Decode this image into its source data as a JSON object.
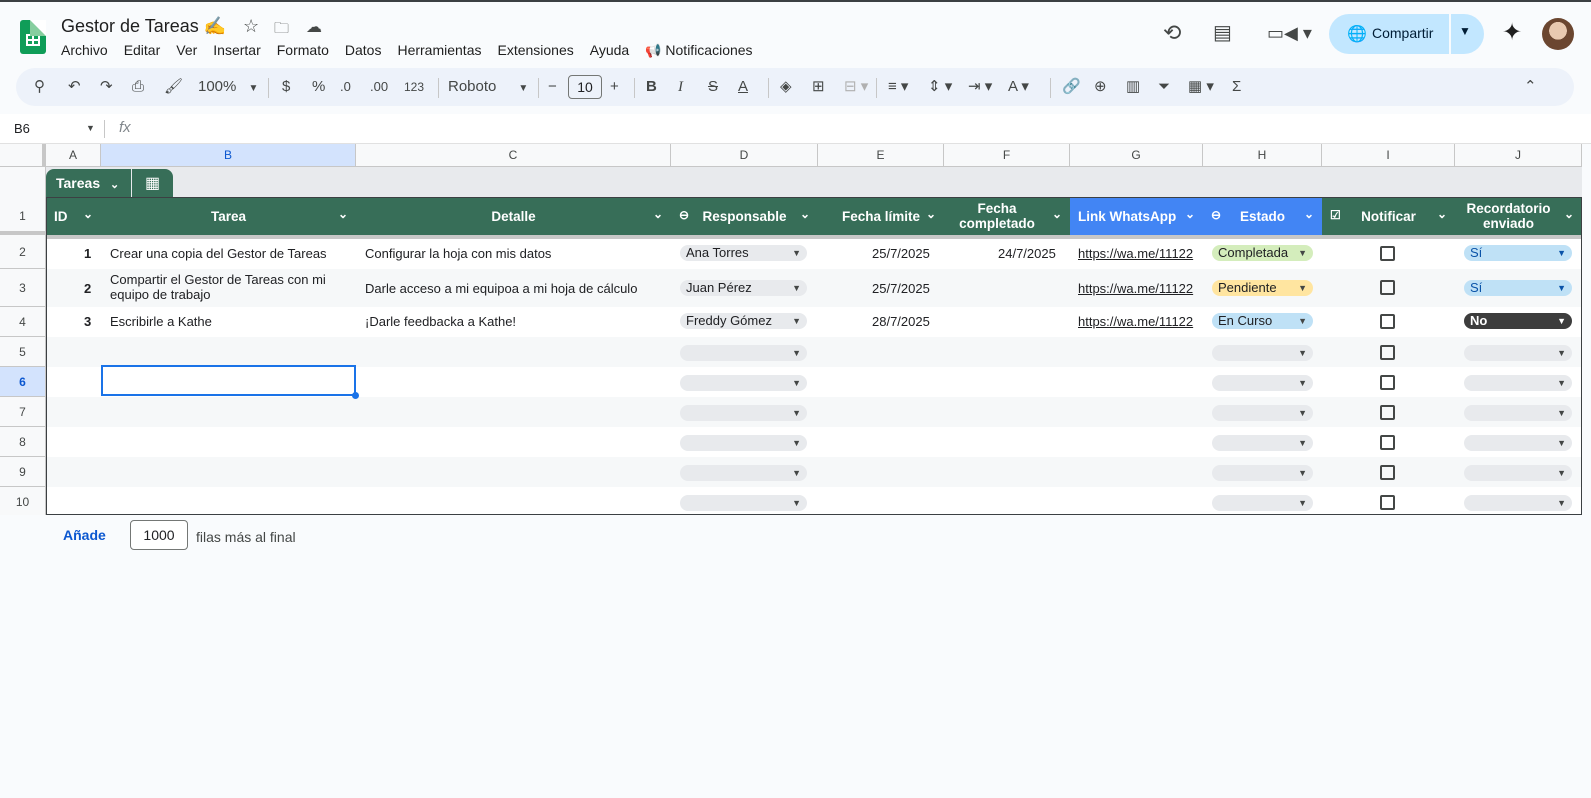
{
  "header": {
    "title": "Gestor de Tareas ✍️",
    "menu": [
      "Archivo",
      "Editar",
      "Ver",
      "Insertar",
      "Formato",
      "Datos",
      "Herramientas",
      "Extensiones",
      "Ayuda"
    ],
    "notifications": "Notificaciones",
    "share_label": "Compartir"
  },
  "toolbar": {
    "zoom": "100%",
    "currency": "$",
    "percent": "%",
    "dec_less": ".0",
    "dec_more": ".00",
    "number_format": "123",
    "font": "Roboto",
    "font_size": "10",
    "bold": "B",
    "italic": "I",
    "text_color": "A",
    "sum": "Σ"
  },
  "formula_bar": {
    "name_box": "B6",
    "fx": "fx"
  },
  "columns": [
    "A",
    "B",
    "C",
    "D",
    "E",
    "F",
    "G",
    "H",
    "I",
    "J"
  ],
  "rows": [
    "1",
    "2",
    "3",
    "4",
    "5",
    "6",
    "7",
    "8",
    "9",
    "10"
  ],
  "table": {
    "name": "Tareas",
    "headers": {
      "id": "ID",
      "tarea": "Tarea",
      "detalle": "Detalle",
      "responsable": "Responsable",
      "fecha_limite": "Fecha límite",
      "fecha_completado": "Fecha completado",
      "link": "Link WhatsApp",
      "estado": "Estado",
      "notificar": "Notificar",
      "recordatorio": "Recordatorio enviado"
    },
    "data": [
      {
        "id": "1",
        "tarea": "Crear una copia del Gestor de Tareas",
        "detalle": "Configurar la hoja con mis datos",
        "responsable": "Ana Torres",
        "fecha_limite": "25/7/2025",
        "fecha_completado": "24/7/2025",
        "link": "https://wa.me/11122",
        "estado": "Completada",
        "estado_color": "#d4edbc",
        "recordatorio": "Sí",
        "rec_color": "#bfe1f6",
        "rec_text": "#0a53a8"
      },
      {
        "id": "2",
        "tarea": "Compartir el Gestor de Tareas con mi equipo de trabajo",
        "detalle": "Darle acceso a mi equipoa a mi hoja de cálculo",
        "responsable": "Juan Pérez",
        "fecha_limite": "25/7/2025",
        "fecha_completado": "",
        "link": "https://wa.me/11122",
        "estado": "Pendiente",
        "estado_color": "#ffe5a0",
        "recordatorio": "Sí",
        "rec_color": "#bfe1f6",
        "rec_text": "#0a53a8"
      },
      {
        "id": "3",
        "tarea": "Escribirle a Kathe",
        "detalle": "¡Darle feedbacka a Kathe!",
        "responsable": "Freddy Gómez",
        "fecha_limite": "28/7/2025",
        "fecha_completado": "",
        "link": "https://wa.me/11122",
        "estado": "En Curso",
        "estado_color": "#bfe1f6",
        "recordatorio": "No",
        "rec_color": "#3d3d3d",
        "rec_text": "#ffffff"
      }
    ]
  },
  "footer": {
    "add_label": "Añade",
    "rows_value": "1000",
    "suffix": "filas más al final"
  }
}
